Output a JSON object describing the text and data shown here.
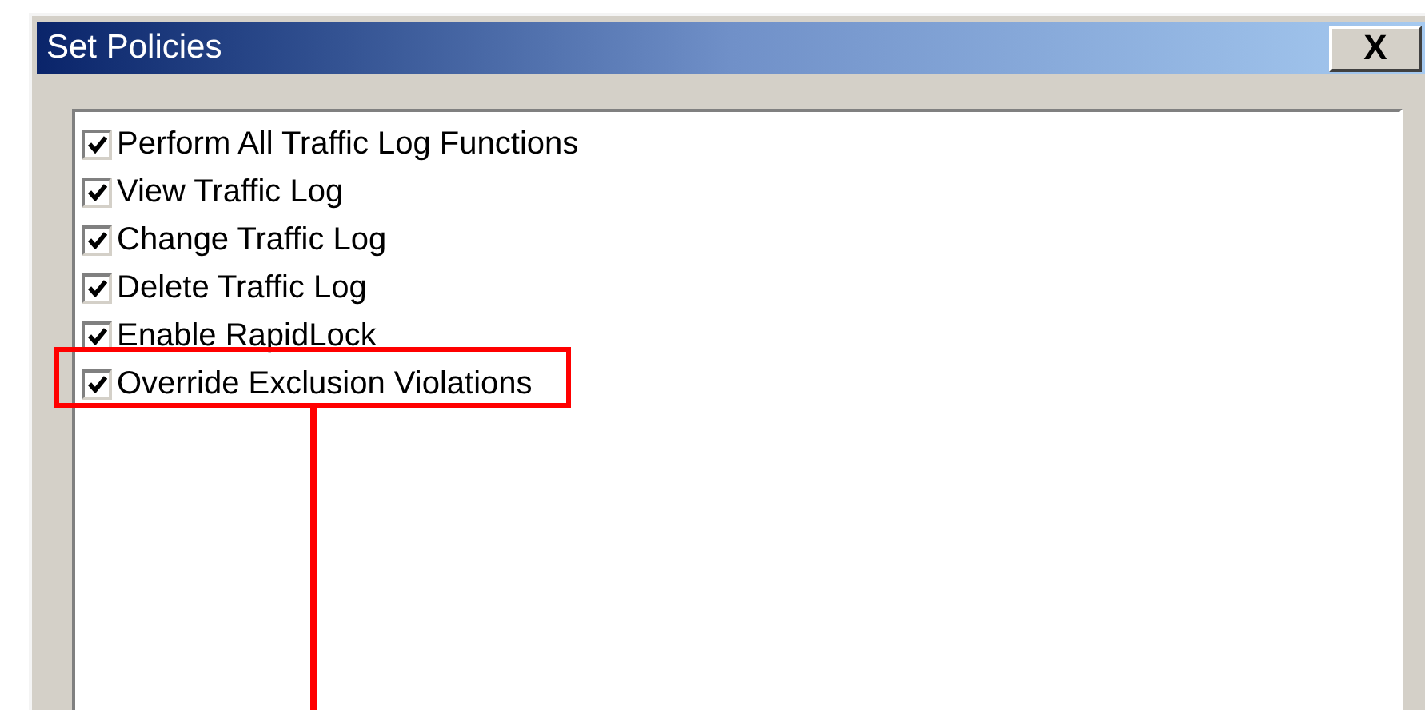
{
  "window": {
    "title": "Set Policies",
    "close_label": "X"
  },
  "policies": [
    {
      "label": "Perform All Traffic Log Functions",
      "checked": true
    },
    {
      "label": "View Traffic Log",
      "checked": true
    },
    {
      "label": "Change Traffic Log",
      "checked": true
    },
    {
      "label": "Delete Traffic Log",
      "checked": true
    },
    {
      "label": "Enable RapidLock",
      "checked": true
    },
    {
      "label": "Override Exclusion Violations",
      "checked": true,
      "highlighted": true
    }
  ]
}
